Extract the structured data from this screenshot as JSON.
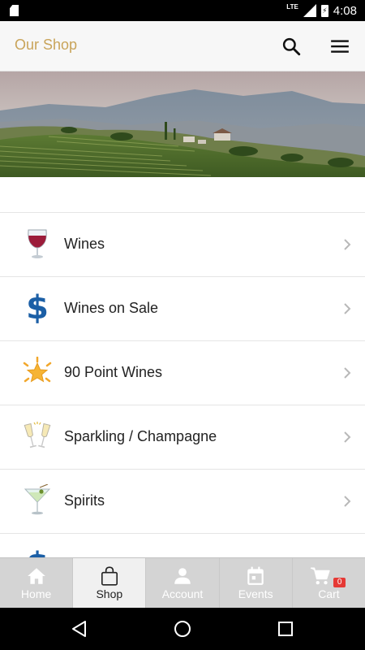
{
  "status_bar": {
    "network": "LTE",
    "time": "4:08"
  },
  "app_bar": {
    "title": "Our Shop"
  },
  "menu_items": [
    {
      "label": "Wines",
      "icon": "wine-glass-icon"
    },
    {
      "label": "Wines on Sale",
      "icon": "dollar-sign-icon"
    },
    {
      "label": "90 Point Wines",
      "icon": "star-burst-icon"
    },
    {
      "label": "Sparkling / Champagne",
      "icon": "champagne-glasses-icon"
    },
    {
      "label": "Spirits",
      "icon": "cocktail-glass-icon"
    }
  ],
  "bottom_nav": [
    {
      "label": "Home",
      "icon": "home-icon",
      "active": false
    },
    {
      "label": "Shop",
      "icon": "shopping-bag-icon",
      "active": true
    },
    {
      "label": "Account",
      "icon": "person-icon",
      "active": false
    },
    {
      "label": "Events",
      "icon": "calendar-icon",
      "active": false
    },
    {
      "label": "Cart",
      "icon": "cart-icon",
      "active": false,
      "badge": "0"
    }
  ],
  "colors": {
    "title": "#c9a45a",
    "badge": "#e53935",
    "dollar": "#1b5fa6"
  }
}
